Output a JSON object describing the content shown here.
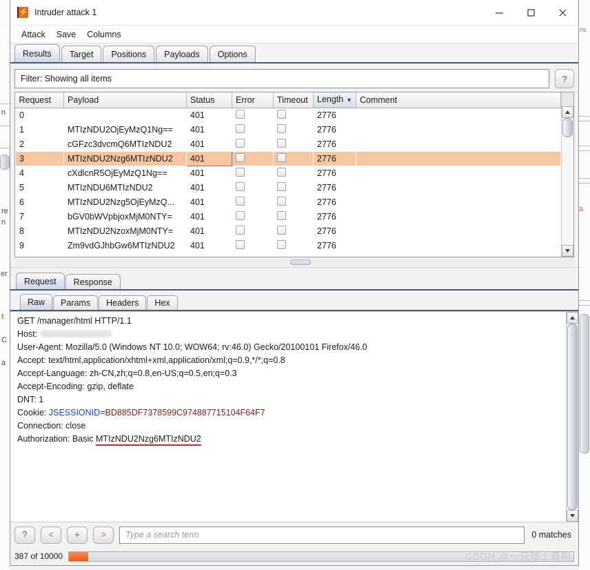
{
  "window": {
    "title": "Intruder attack 1",
    "icon": "burp-suite-icon",
    "minimize_label": "—",
    "maximize_label": "□",
    "close_label": "✕"
  },
  "menu": {
    "items": [
      {
        "label": "Attack"
      },
      {
        "label": "Save"
      },
      {
        "label": "Columns"
      }
    ]
  },
  "tabs": {
    "items": [
      {
        "label": "Results",
        "active": true
      },
      {
        "label": "Target",
        "active": false
      },
      {
        "label": "Positions",
        "active": false
      },
      {
        "label": "Payloads",
        "active": false
      },
      {
        "label": "Options",
        "active": false
      }
    ]
  },
  "filter": {
    "text": "Filter: Showing all items",
    "help_label": "?"
  },
  "results_table": {
    "columns": [
      {
        "label": "Request",
        "sorted": false
      },
      {
        "label": "Payload",
        "sorted": false
      },
      {
        "label": "Status",
        "sorted": false
      },
      {
        "label": "Error",
        "sorted": false
      },
      {
        "label": "Timeout",
        "sorted": false
      },
      {
        "label": "Length",
        "sorted": true,
        "sort_arrow": "▼"
      },
      {
        "label": "Comment",
        "sorted": false
      }
    ],
    "rows": [
      {
        "request": "0",
        "payload": "",
        "status": "401",
        "error": false,
        "timeout": false,
        "length": "2776",
        "comment": "",
        "selected": false
      },
      {
        "request": "1",
        "payload": "MTIzNDU2OjEyMzQ1Ng==",
        "status": "401",
        "error": false,
        "timeout": false,
        "length": "2776",
        "comment": "",
        "selected": false
      },
      {
        "request": "2",
        "payload": "cGFzc3dvcmQ6MTIzNDU2",
        "status": "401",
        "error": false,
        "timeout": false,
        "length": "2776",
        "comment": "",
        "selected": false
      },
      {
        "request": "3",
        "payload": "MTIzNDU2Nzg6MTIzNDU2",
        "status": "401",
        "error": false,
        "timeout": false,
        "length": "2776",
        "comment": "",
        "selected": true
      },
      {
        "request": "4",
        "payload": "cXdlcnR5OjEyMzQ1Ng==",
        "status": "401",
        "error": false,
        "timeout": false,
        "length": "2776",
        "comment": "",
        "selected": false
      },
      {
        "request": "5",
        "payload": "MTIzNDU6MTIzNDU2",
        "status": "401",
        "error": false,
        "timeout": false,
        "length": "2776",
        "comment": "",
        "selected": false
      },
      {
        "request": "6",
        "payload": "MTIzNDU2Nzg5OjEyMzQ...",
        "status": "401",
        "error": false,
        "timeout": false,
        "length": "2776",
        "comment": "",
        "selected": false
      },
      {
        "request": "7",
        "payload": "bGV0bWVpbjoxMjM0NTY=",
        "status": "401",
        "error": false,
        "timeout": false,
        "length": "2776",
        "comment": "",
        "selected": false
      },
      {
        "request": "8",
        "payload": "MTIzNDU2NzoxMjM0NTY=",
        "status": "401",
        "error": false,
        "timeout": false,
        "length": "2776",
        "comment": "",
        "selected": false
      },
      {
        "request": "9",
        "payload": "Zm9vdGJhbGw6MTIzNDU2",
        "status": "401",
        "error": false,
        "timeout": false,
        "length": "2776",
        "comment": "",
        "selected": false
      }
    ]
  },
  "message_tabs": {
    "items": [
      {
        "label": "Request",
        "active": true
      },
      {
        "label": "Response",
        "active": false
      }
    ]
  },
  "view_tabs": {
    "items": [
      {
        "label": "Raw",
        "active": true
      },
      {
        "label": "Params",
        "active": false
      },
      {
        "label": "Headers",
        "active": false
      },
      {
        "label": "Hex",
        "active": false
      }
    ]
  },
  "request": {
    "request_line": "GET /manager/html HTTP/1.1",
    "host_label": "Host:",
    "host_value_redacted": true,
    "user_agent": "User-Agent: Mozilla/5.0 (Windows NT 10.0; WOW64; rv:46.0) Gecko/20100101 Firefox/46.0",
    "accept": "Accept: text/html,application/xhtml+xml,application/xml;q=0.9,*/*;q=0.8",
    "accept_language": "Accept-Language: zh-CN,zh;q=0.8,en-US;q=0.5,en;q=0.3",
    "accept_encoding": "Accept-Encoding: gzip, deflate",
    "dnt": "DNT: 1",
    "cookie_prefix": "Cookie: ",
    "cookie_name": "JSESSIONID",
    "cookie_eq": "=",
    "cookie_value": "BD885DF7378599C974887715104F64F7",
    "connection": "Connection: close",
    "auth_prefix": "Authorization: Basic ",
    "auth_payload": "MTIzNDU2Nzg6MTIzNDU2"
  },
  "search": {
    "help_label": "?",
    "prev_label": "<",
    "add_label": "+",
    "next_label": ">",
    "placeholder": "Type a search term",
    "value": "",
    "matches": "0 matches"
  },
  "status": {
    "progress_text": "387 of 10000",
    "progress_current": 387,
    "progress_total": 10000,
    "progress_percent": 3.87,
    "watermark": "CSDN @一只哈士奇叫"
  },
  "colors": {
    "accent_orange": "#ec6625",
    "selected_row": "#f7c59f",
    "tab_active": "#ccd6e7",
    "cookie_name": "#1a3fd4",
    "cookie_value": "#8c1a1a",
    "auth_underline": "#e02020"
  }
}
